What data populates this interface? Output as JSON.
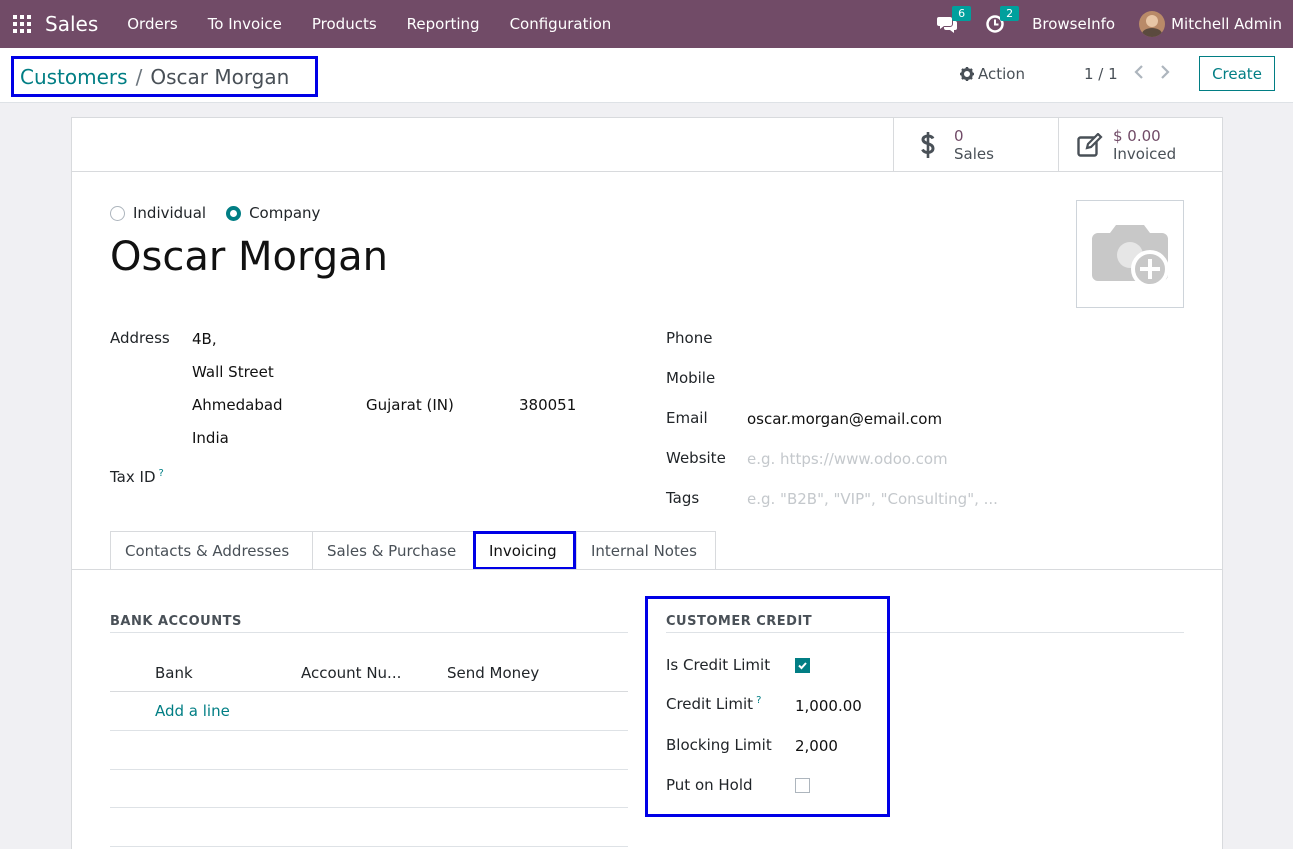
{
  "navbar": {
    "app_name": "Sales",
    "menu": [
      "Orders",
      "To Invoice",
      "Products",
      "Reporting",
      "Configuration"
    ],
    "messages_count": "6",
    "activities_count": "2",
    "browse_info": "BrowseInfo",
    "user_name": "Mitchell Admin"
  },
  "control_panel": {
    "breadcrumb_parent": "Customers",
    "breadcrumb_separator": "/",
    "breadcrumb_current": "Oscar Morgan",
    "action_label": "Action",
    "pager": "1 / 1",
    "create_label": "Create"
  },
  "stat_buttons": {
    "sales_value": "0",
    "sales_label": "Sales",
    "invoiced_value": "$ 0.00",
    "invoiced_label": "Invoiced"
  },
  "company_type": {
    "individual_label": "Individual",
    "company_label": "Company",
    "selected": "Company"
  },
  "partner": {
    "name": "Oscar Morgan",
    "address_label": "Address",
    "street": "4B,",
    "street2": "Wall Street",
    "city": "Ahmedabad",
    "state": "Gujarat (IN)",
    "zip": "380051",
    "country": "India",
    "tax_id_label": "Tax ID",
    "tooltip_mark": "?",
    "phone_label": "Phone",
    "mobile_label": "Mobile",
    "email_label": "Email",
    "email": "oscar.morgan@email.com",
    "website_label": "Website",
    "website_placeholder": "e.g. https://www.odoo.com",
    "tags_label": "Tags",
    "tags_placeholder": "e.g. \"B2B\", \"VIP\", \"Consulting\", ..."
  },
  "tabs": [
    "Contacts & Addresses",
    "Sales & Purchase",
    "Invoicing",
    "Internal Notes"
  ],
  "active_tab": "Invoicing",
  "bank_accounts": {
    "title": "BANK ACCOUNTS",
    "columns": [
      "Bank",
      "Account Nu...",
      "Send Money"
    ],
    "add_line": "Add a line"
  },
  "customer_credit": {
    "title": "CUSTOMER CREDIT",
    "is_credit_limit_label": "Is Credit Limit",
    "is_credit_limit": true,
    "credit_limit_label": "Credit Limit",
    "credit_limit": "1,000.00",
    "blocking_limit_label": "Blocking Limit",
    "blocking_limit": "2,000",
    "put_on_hold_label": "Put on Hold",
    "put_on_hold": false
  },
  "colors": {
    "brand": "#714b67",
    "accent": "#017e84",
    "badge": "#00a09d",
    "highlight": "#0000e6"
  }
}
